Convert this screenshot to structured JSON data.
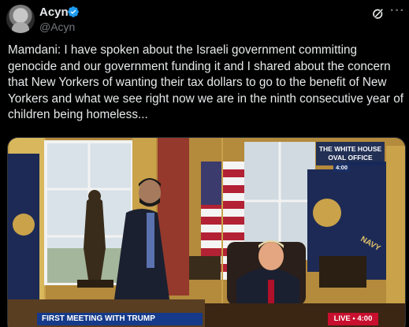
{
  "author": {
    "display_name": "Acyn",
    "handle": "@Acyn",
    "avatar_icon": "avatar-photo",
    "verified_icon": "verified-badge-icon",
    "verified_color": "#1d9bf0"
  },
  "actions": {
    "grok_icon": "grok-icon",
    "more_icon": "more-options-icon"
  },
  "post": {
    "text": "Mamdani: I have spoken about the Israeli government committing genocide and our government funding it and I shared about the concern that New Yorkers of wanting their tax dollars to go to the benefit of New Yorkers and what we see right now we are in the ninth consecutive year of children being homeless..."
  },
  "media": {
    "overlay_title": "THE WHITE HOUSE OVAL OFFICE",
    "overlay_time": "4:00",
    "chyron": "FIRST MEETING WITH TRUMP",
    "live": "LIVE • 4:00",
    "accent_blue": "#153a8a",
    "live_red": "#c8102e"
  }
}
